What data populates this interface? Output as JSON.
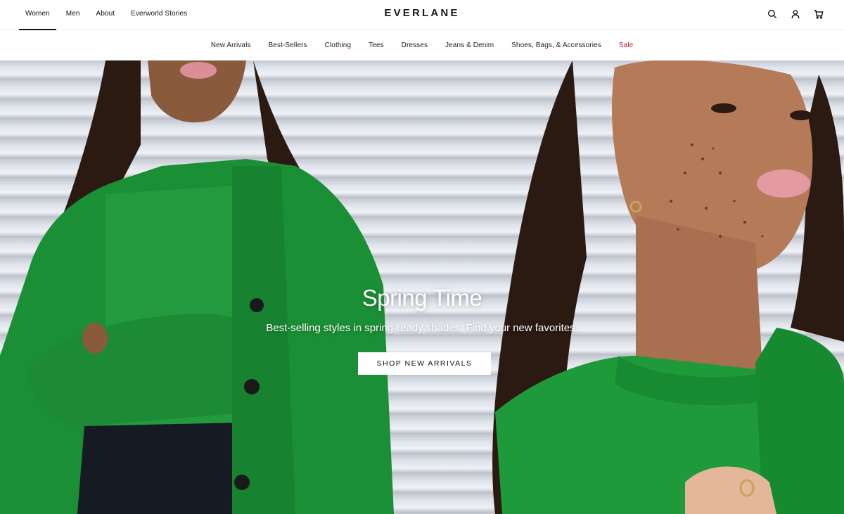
{
  "top_nav": {
    "tabs": [
      {
        "label": "Women",
        "active": true
      },
      {
        "label": "Men",
        "active": false
      },
      {
        "label": "About",
        "active": false
      },
      {
        "label": "Everworld Stories",
        "active": false
      }
    ],
    "logo": "EVERLANE",
    "icons": [
      "search-icon",
      "account-icon",
      "cart-icon"
    ]
  },
  "category_nav": {
    "items": [
      {
        "label": "New Arrivals"
      },
      {
        "label": "Best-Sellers"
      },
      {
        "label": "Clothing"
      },
      {
        "label": "Tees"
      },
      {
        "label": "Dresses"
      },
      {
        "label": "Jeans & Denim"
      },
      {
        "label": "Shoes, Bags, & Accessories"
      },
      {
        "label": "Sale"
      }
    ],
    "sale_color": "#c8102e"
  },
  "hero": {
    "title": "Spring Time",
    "subtitle": "Best-selling styles in spring-ready shades. Find your new favorites.",
    "cta_label": "SHOP NEW ARRIVALS",
    "accent_color": "#1f9a3a"
  }
}
